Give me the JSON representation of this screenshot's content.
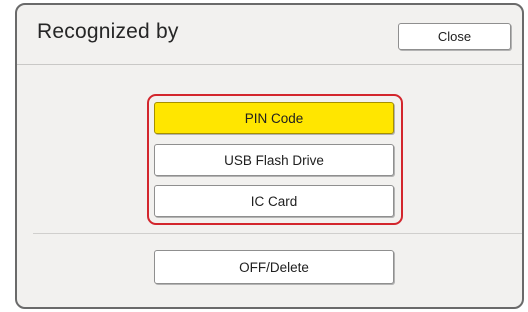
{
  "dialog": {
    "title": "Recognized by",
    "close_label": "Close"
  },
  "options": {
    "items": [
      {
        "label": "PIN Code",
        "selected": true
      },
      {
        "label": "USB Flash Drive",
        "selected": false
      },
      {
        "label": "IC Card",
        "selected": false
      }
    ],
    "selected_color": "#ffe600",
    "highlight_color": "#d3262d"
  },
  "footer": {
    "off_delete_label": "OFF/Delete"
  }
}
